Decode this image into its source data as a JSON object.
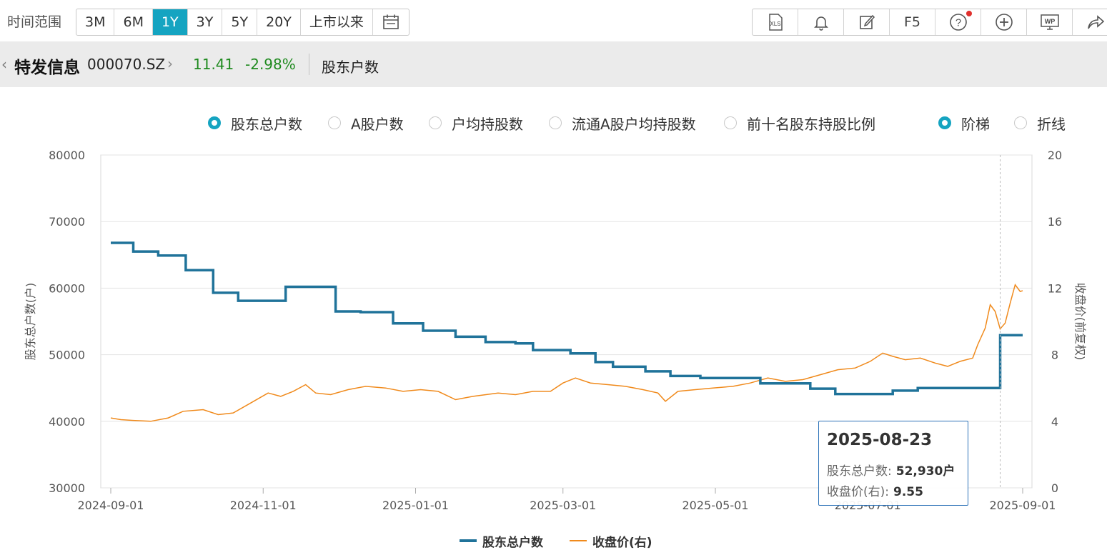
{
  "toolbar": {
    "range_label": "时间范围",
    "ranges": [
      "3M",
      "6M",
      "1Y",
      "3Y",
      "5Y",
      "20Y",
      "上市以来"
    ],
    "active_range": "1Y",
    "tools": [
      {
        "name": "xls",
        "label": "XLS"
      },
      {
        "name": "bell",
        "label": ""
      },
      {
        "name": "edit",
        "label": ""
      },
      {
        "name": "f5",
        "label": "F5"
      },
      {
        "name": "help",
        "label": "?"
      },
      {
        "name": "add",
        "label": ""
      },
      {
        "name": "wp",
        "label": "WP"
      },
      {
        "name": "share",
        "label": ""
      }
    ]
  },
  "stock": {
    "name": "特发信息",
    "code": "000070.SZ",
    "price": "11.41",
    "change": "-2.98%",
    "section": "股东户数"
  },
  "options": {
    "metrics": [
      "股东总户数",
      "A股户数",
      "户均持股数",
      "流通A股户均持股数",
      "前十名股东持股比例"
    ],
    "selected_metric": "股东总户数",
    "styles": [
      "阶梯",
      "折线"
    ],
    "selected_style": "阶梯"
  },
  "colors": {
    "accent": "#15a4c1",
    "holders_line": "#20739a",
    "price_line": "#f08a1c",
    "up_down_green": "#1f8a1f"
  },
  "tooltip": {
    "date": "2025-08-23",
    "row1_label": "股东总户数:",
    "row1_value": "52,930户",
    "row2_label": "收盘价(右):",
    "row2_value": "9.55"
  },
  "chart_data": {
    "type": "line",
    "left_axis": {
      "label": "股东总户数(户)",
      "ticks": [
        30000,
        40000,
        50000,
        60000,
        70000,
        80000
      ],
      "range": [
        30000,
        80000
      ]
    },
    "right_axis": {
      "label": "收盘价(前复权)",
      "ticks": [
        0,
        4,
        8,
        12,
        16,
        20
      ],
      "range": [
        0,
        20
      ]
    },
    "x_ticks": [
      "2024-09-01",
      "2024-11-01",
      "2025-01-01",
      "2025-03-01",
      "2025-05-01",
      "2025-07-01",
      "2025-09-01"
    ],
    "x_range": [
      "2024-09-01",
      "2025-09-01"
    ],
    "grid": true,
    "legend_position": "bottom-center",
    "series": [
      {
        "name": "股东总户数",
        "axis": "left",
        "style": "step",
        "points": [
          [
            "2024-09-01",
            66800
          ],
          [
            "2024-09-10",
            65500
          ],
          [
            "2024-09-20",
            64900
          ],
          [
            "2024-10-01",
            62700
          ],
          [
            "2024-10-12",
            59300
          ],
          [
            "2024-10-22",
            58100
          ],
          [
            "2024-11-10",
            60200
          ],
          [
            "2024-11-30",
            56500
          ],
          [
            "2024-12-10",
            56400
          ],
          [
            "2024-12-23",
            54700
          ],
          [
            "2025-01-04",
            53600
          ],
          [
            "2025-01-17",
            52700
          ],
          [
            "2025-01-29",
            51900
          ],
          [
            "2025-02-10",
            51700
          ],
          [
            "2025-02-17",
            50700
          ],
          [
            "2025-03-04",
            50200
          ],
          [
            "2025-03-14",
            48900
          ],
          [
            "2025-03-21",
            48200
          ],
          [
            "2025-04-03",
            47500
          ],
          [
            "2025-04-13",
            46800
          ],
          [
            "2025-04-25",
            46500
          ],
          [
            "2025-05-19",
            45700
          ],
          [
            "2025-06-08",
            44900
          ],
          [
            "2025-06-18",
            44100
          ],
          [
            "2025-07-11",
            44600
          ],
          [
            "2025-07-21",
            45000
          ],
          [
            "2025-08-23",
            52930
          ],
          [
            "2025-09-01",
            52930
          ]
        ]
      },
      {
        "name": "收盘价(右)",
        "axis": "right",
        "style": "line",
        "points": [
          [
            "2024-09-01",
            4.2
          ],
          [
            "2024-09-05",
            4.1
          ],
          [
            "2024-09-10",
            4.05
          ],
          [
            "2024-09-17",
            4.0
          ],
          [
            "2024-09-24",
            4.2
          ],
          [
            "2024-09-30",
            4.6
          ],
          [
            "2024-10-08",
            4.7
          ],
          [
            "2024-10-14",
            4.4
          ],
          [
            "2024-10-20",
            4.5
          ],
          [
            "2024-10-27",
            5.1
          ],
          [
            "2024-11-03",
            5.7
          ],
          [
            "2024-11-08",
            5.5
          ],
          [
            "2024-11-13",
            5.8
          ],
          [
            "2024-11-18",
            6.2
          ],
          [
            "2024-11-22",
            5.7
          ],
          [
            "2024-11-28",
            5.6
          ],
          [
            "2024-12-05",
            5.9
          ],
          [
            "2024-12-12",
            6.1
          ],
          [
            "2024-12-20",
            6.0
          ],
          [
            "2024-12-27",
            5.8
          ],
          [
            "2025-01-03",
            5.9
          ],
          [
            "2025-01-10",
            5.8
          ],
          [
            "2025-01-17",
            5.3
          ],
          [
            "2025-01-24",
            5.5
          ],
          [
            "2025-02-03",
            5.7
          ],
          [
            "2025-02-10",
            5.6
          ],
          [
            "2025-02-17",
            5.8
          ],
          [
            "2025-02-24",
            5.8
          ],
          [
            "2025-03-01",
            6.3
          ],
          [
            "2025-03-06",
            6.6
          ],
          [
            "2025-03-12",
            6.3
          ],
          [
            "2025-03-19",
            6.2
          ],
          [
            "2025-03-26",
            6.1
          ],
          [
            "2025-04-02",
            5.9
          ],
          [
            "2025-04-08",
            5.7
          ],
          [
            "2025-04-11",
            5.2
          ],
          [
            "2025-04-16",
            5.8
          ],
          [
            "2025-04-23",
            5.9
          ],
          [
            "2025-04-30",
            6.0
          ],
          [
            "2025-05-08",
            6.1
          ],
          [
            "2025-05-15",
            6.3
          ],
          [
            "2025-05-22",
            6.6
          ],
          [
            "2025-05-29",
            6.4
          ],
          [
            "2025-06-05",
            6.5
          ],
          [
            "2025-06-12",
            6.8
          ],
          [
            "2025-06-19",
            7.1
          ],
          [
            "2025-06-26",
            7.2
          ],
          [
            "2025-07-02",
            7.6
          ],
          [
            "2025-07-07",
            8.1
          ],
          [
            "2025-07-11",
            7.9
          ],
          [
            "2025-07-16",
            7.7
          ],
          [
            "2025-07-22",
            7.8
          ],
          [
            "2025-07-28",
            7.5
          ],
          [
            "2025-08-02",
            7.3
          ],
          [
            "2025-08-07",
            7.6
          ],
          [
            "2025-08-12",
            7.8
          ],
          [
            "2025-08-14",
            8.6
          ],
          [
            "2025-08-17",
            9.6
          ],
          [
            "2025-08-19",
            11.0
          ],
          [
            "2025-08-21",
            10.6
          ],
          [
            "2025-08-23",
            9.55
          ],
          [
            "2025-08-25",
            9.9
          ],
          [
            "2025-08-27",
            11.1
          ],
          [
            "2025-08-29",
            12.2
          ],
          [
            "2025-08-31",
            11.8
          ],
          [
            "2025-09-01",
            11.85
          ]
        ]
      }
    ]
  }
}
